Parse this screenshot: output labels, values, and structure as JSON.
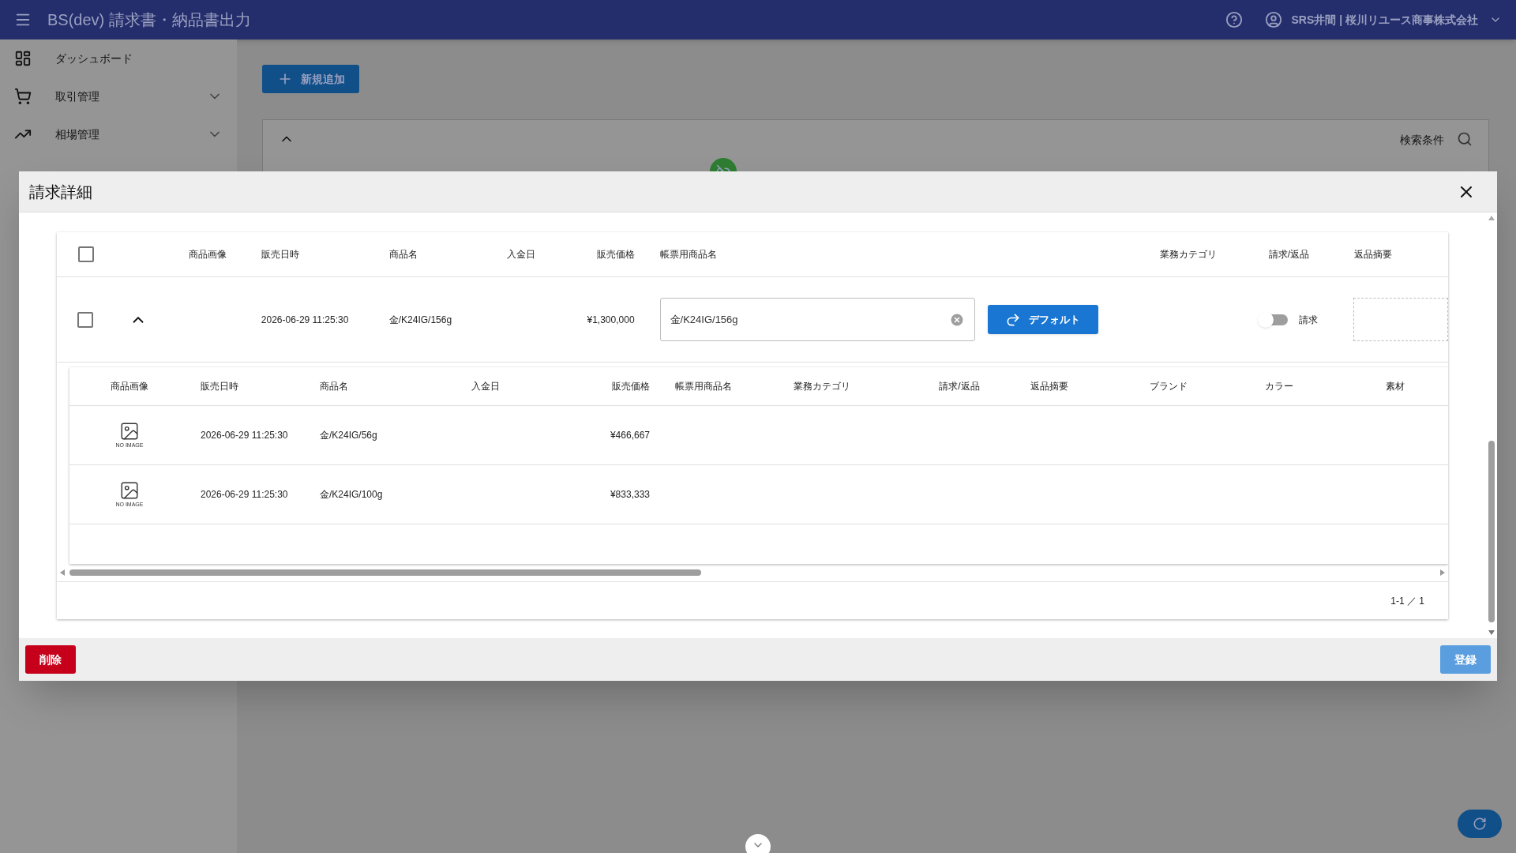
{
  "app_bar": {
    "title": "BS(dev) 請求書・納品書出力",
    "user": "SRS井間 | 桜川リユース商事株式会社"
  },
  "sidebar": {
    "items": [
      {
        "label": "ダッシュボード",
        "expandable": false
      },
      {
        "label": "取引管理",
        "expandable": true
      },
      {
        "label": "相場管理",
        "expandable": true
      }
    ]
  },
  "page": {
    "add_button": "新規追加",
    "search_label": "検索条件"
  },
  "dialog": {
    "title": "請求詳細",
    "table": {
      "select_all_checked": false,
      "columns": [
        "商品画像",
        "販売日時",
        "商品名",
        "入金日",
        "販売価格",
        "帳票用商品名",
        "業務カテゴリ",
        "請求/返品",
        "返品摘要"
      ],
      "rows": [
        {
          "checked": false,
          "expanded": true,
          "sale_datetime": "2026-06-29 11:25:30",
          "product_name": "金/K24IG/156g",
          "price": "¥1,300,000",
          "invoice_name": "金/K24IG/156g",
          "default_button": "デフォルト",
          "return_on": false,
          "return_label": "請求"
        }
      ]
    },
    "sub_table": {
      "columns": [
        "商品画像",
        "販売日時",
        "商品名",
        "入金日",
        "販売価格",
        "帳票用商品名",
        "業務カテゴリ",
        "請求/返品",
        "返品摘要",
        "ブランド",
        "カラー",
        "素材"
      ],
      "rows": [
        {
          "image_text": "NO IMAGE",
          "sale_datetime": "2026-06-29 11:25:30",
          "product_name": "金/K24IG/56g",
          "price": "¥466,667"
        },
        {
          "image_text": "NO IMAGE",
          "sale_datetime": "2026-06-29 11:25:30",
          "product_name": "金/K24IG/100g",
          "price": "¥833,333"
        }
      ]
    },
    "pagination": "1-1 ／ 1",
    "delete_button": "削除",
    "register_button": "登録"
  }
}
